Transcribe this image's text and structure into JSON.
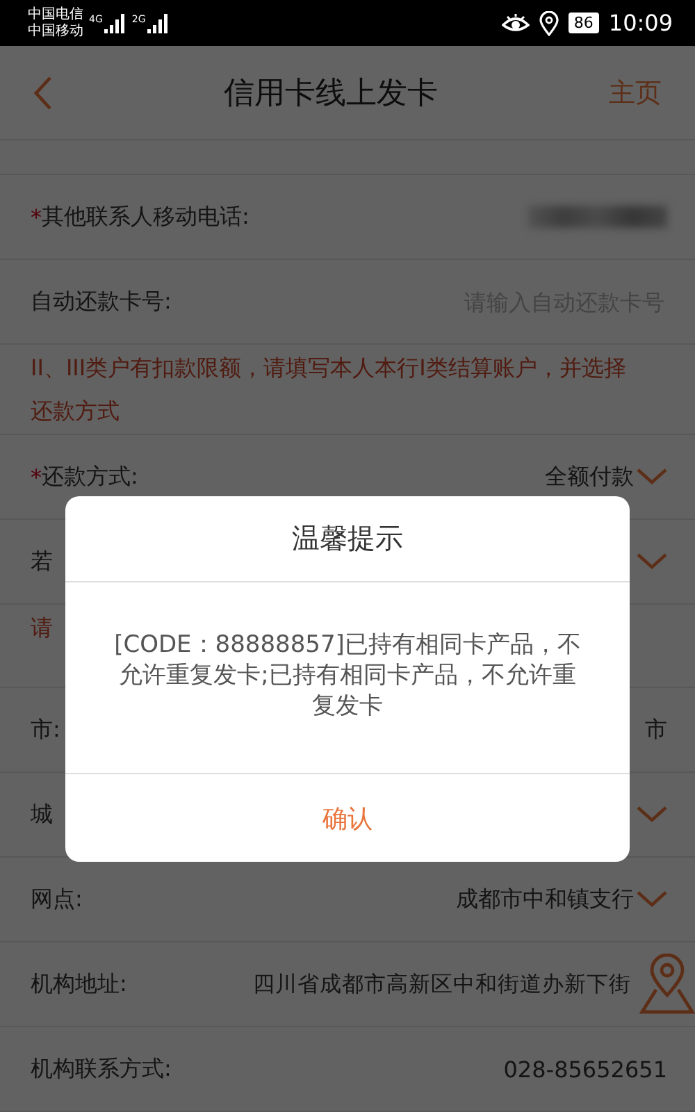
{
  "status_bar": {
    "carriers": [
      "中国电信",
      "中国移动"
    ],
    "networks": [
      "4G",
      "2G"
    ],
    "battery": "86",
    "time": "10:09"
  },
  "header": {
    "title": "信用卡线上发卡",
    "right_link": "主页"
  },
  "rows": [
    {
      "kind": "stub"
    },
    {
      "kind": "field",
      "mark": "*",
      "label": "其他联系人移动电话:",
      "blurred": true
    },
    {
      "kind": "field",
      "label": "自动还款卡号:",
      "placeholder": "请输入自动还款卡号"
    },
    {
      "kind": "notice",
      "text": "II、III类户有扣款限额，请填写本人本行I类结算账户，并选择还款方式"
    },
    {
      "kind": "field",
      "mark": "*",
      "label": "还款方式:",
      "value": "全额付款",
      "dropdown": true
    },
    {
      "kind": "field",
      "label": "若",
      "dropdown": true
    },
    {
      "kind": "notice",
      "text": "请"
    },
    {
      "kind": "field",
      "label": "市:",
      "value": "市"
    },
    {
      "kind": "field",
      "label": "城",
      "dropdown": true
    },
    {
      "kind": "field",
      "label": "网点:",
      "value": "成都市中和镇支行",
      "dropdown": true
    },
    {
      "kind": "field",
      "label": "机构地址:",
      "value": "四川省成都市高新区中和街道办新下街",
      "map": true
    },
    {
      "kind": "field",
      "label": "机构联系方式:",
      "value": "028-85652651"
    }
  ],
  "dialog": {
    "title": "温馨提示",
    "message": "[CODE：88888857]已持有相同卡产品，不允许重复发卡;已持有相同卡产品，不允许重复发卡",
    "button": "确认"
  }
}
